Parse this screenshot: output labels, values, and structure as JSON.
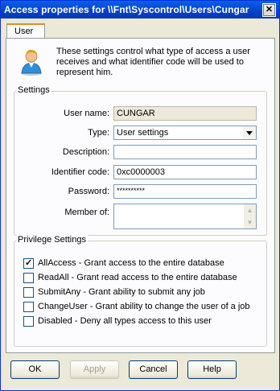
{
  "window": {
    "title": "Access properties for \\\\Fnt\\Syscontrol\\Users\\Cungar",
    "close_glyph": "✕"
  },
  "tabs": [
    {
      "label": "User"
    }
  ],
  "description": "These settings control what type of access a user receives and what identifier code will be used to represent him.",
  "icon": "user-avatar-icon",
  "settings": {
    "legend": "Settings",
    "user_name": {
      "label": "User name:",
      "value": "CUNGAR"
    },
    "type": {
      "label": "Type:",
      "value": "User settings"
    },
    "description": {
      "label": "Description:",
      "value": ""
    },
    "identifier": {
      "label": "Identifier code:",
      "value": "0xc0000003"
    },
    "password": {
      "label": "Password:",
      "value": "**********"
    },
    "member_of": {
      "label": "Member of:",
      "value": ""
    }
  },
  "privileges": {
    "legend": "Privilege Settings",
    "items": [
      {
        "label": "AllAccess - Grant access to the entire database",
        "checked": true
      },
      {
        "label": "ReadAll - Grant read access to the entire database",
        "checked": false
      },
      {
        "label": "SubmitAny - Grant ability to submit any job",
        "checked": false
      },
      {
        "label": "ChangeUser - Grant ability to change the user of a job",
        "checked": false
      },
      {
        "label": "Disabled - Deny all types access to this user",
        "checked": false
      }
    ]
  },
  "buttons": {
    "ok": "OK",
    "apply": "Apply",
    "cancel": "Cancel",
    "help": "Help"
  }
}
